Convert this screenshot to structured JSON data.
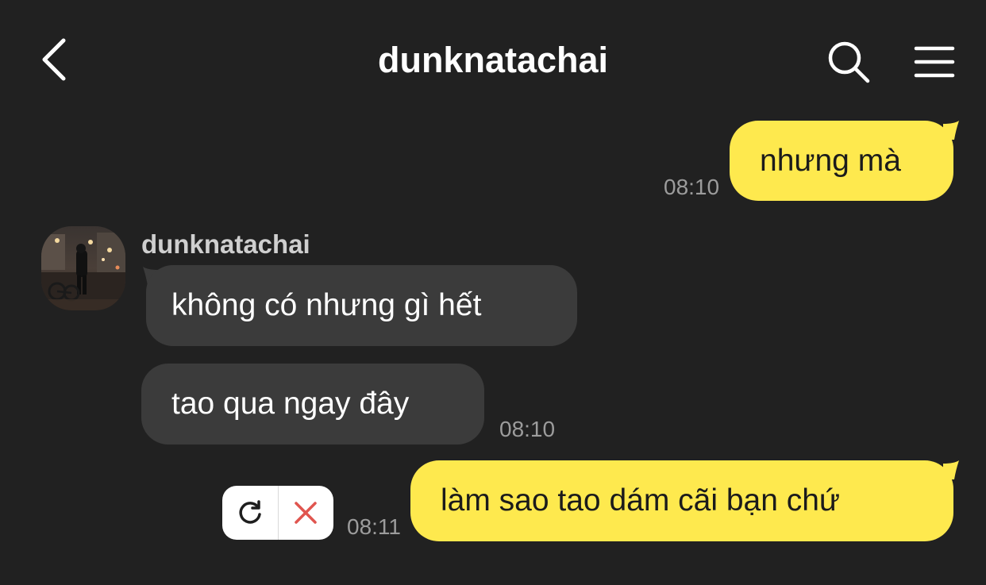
{
  "header": {
    "title": "dunknatachai",
    "back_icon": "chevron-left-icon",
    "search_icon": "search-icon",
    "menu_icon": "hamburger-menu-icon"
  },
  "messages": [
    {
      "direction": "out",
      "text": "nhưng mà",
      "time": "08:10"
    },
    {
      "direction": "in",
      "sender": "dunknatachai",
      "text": "không có nhưng gì hết"
    },
    {
      "direction": "in",
      "text": "tao qua ngay đây",
      "time": "08:10"
    },
    {
      "direction": "out",
      "text": "làm sao tao dám cãi bạn chứ",
      "time": "08:11",
      "status": "failed"
    }
  ],
  "failed_actions": {
    "retry_icon": "refresh-icon",
    "delete_icon": "close-icon"
  },
  "colors": {
    "background": "#212121",
    "outgoing_bubble": "#fee94e",
    "incoming_bubble": "#3b3b3b",
    "timestamp": "#9c9c9c",
    "delete_red": "#e0554f"
  }
}
